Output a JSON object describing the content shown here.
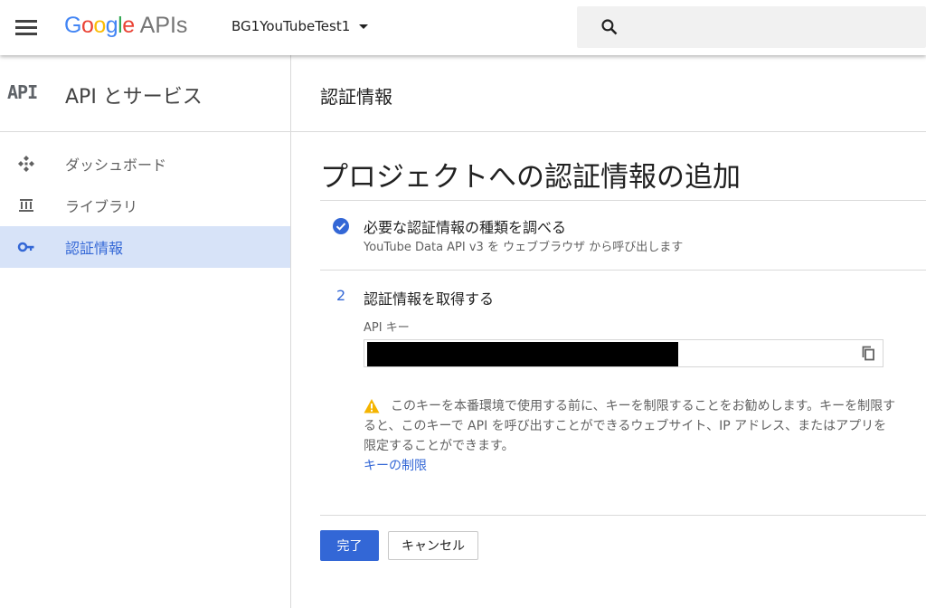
{
  "header": {
    "logo_google": [
      "G",
      "o",
      "o",
      "g",
      "l",
      "e"
    ],
    "logo_colors": [
      "#4285F4",
      "#EA4335",
      "#FBBC05",
      "#4285F4",
      "#34A853",
      "#EA4335"
    ],
    "logo_suffix": "APIs",
    "project_name": "BG1YouTubeTest1"
  },
  "sidebar": {
    "badge": "API",
    "title": "API とサービス",
    "items": [
      {
        "label": "ダッシュボード",
        "icon": "dashboard-icon",
        "active": false
      },
      {
        "label": "ライブラリ",
        "icon": "library-icon",
        "active": true
      },
      {
        "label": "認証情報",
        "icon": "key-icon",
        "active": true
      }
    ]
  },
  "main": {
    "header_title": "認証情報",
    "page_title": "プロジェクトへの認証情報の追加",
    "step1": {
      "title": "必要な認証情報の種類を調べる",
      "subtitle": "YouTube Data API v3 を ウェブブラウザ から呼び出します"
    },
    "step2": {
      "number": "2",
      "title": "認証情報を取得する",
      "field_label": "API キー"
    },
    "warning": {
      "text": "このキーを本番環境で使用する前に、キーを制限することをお勧めします。キーを制限すると、このキーで API を呼び出すことができるウェブサイト、IP アドレス、またはアプリを限定することができます。",
      "link": "キーの制限"
    },
    "buttons": {
      "done": "完了",
      "cancel": "キャンセル"
    }
  },
  "colors": {
    "accent": "#3367d6",
    "active_bg": "#d7e3f8",
    "warning": "#f4b400"
  }
}
